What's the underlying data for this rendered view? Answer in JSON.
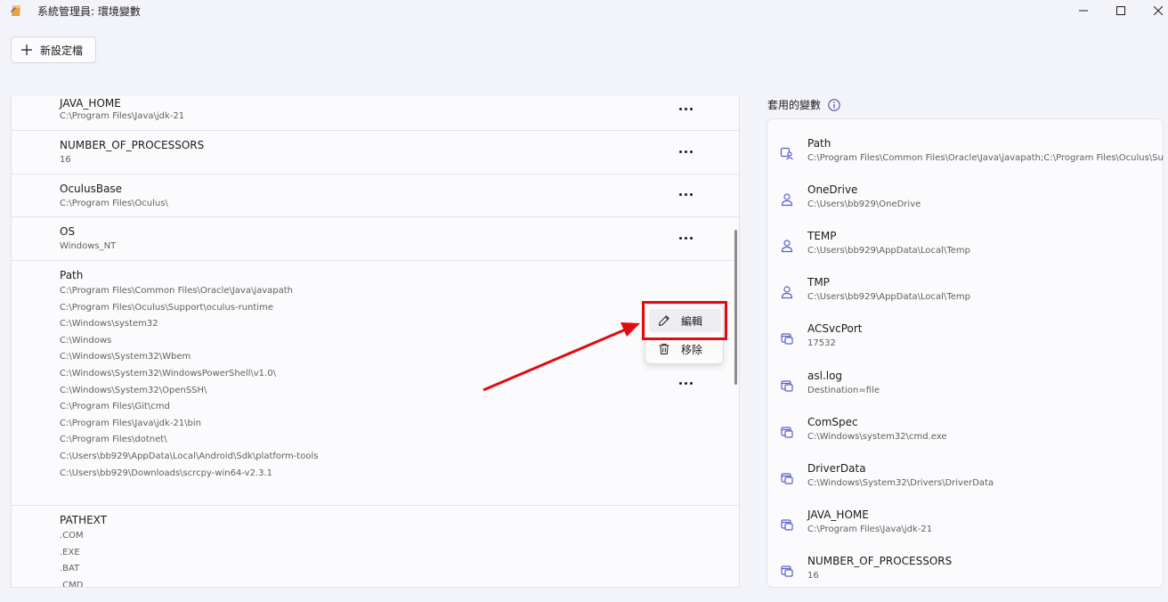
{
  "window": {
    "title": "系統管理員: 環境變數",
    "colors": {
      "accent": "#5b5fc7",
      "highlight": "#e00c10"
    }
  },
  "toolbar": {
    "new_profile_label": "新設定檔"
  },
  "variables": [
    {
      "name": "JAVA_HOME",
      "values": [
        "C:\\Program Files\\Java\\jdk-21"
      ]
    },
    {
      "name": "NUMBER_OF_PROCESSORS",
      "values": [
        "16"
      ]
    },
    {
      "name": "OculusBase",
      "values": [
        "C:\\Program Files\\Oculus\\"
      ]
    },
    {
      "name": "OS",
      "values": [
        "Windows_NT"
      ]
    },
    {
      "name": "Path",
      "values": [
        "C:\\Program Files\\Common Files\\Oracle\\Java\\javapath",
        "C:\\Program Files\\Oculus\\Support\\oculus-runtime",
        "C:\\Windows\\system32",
        "C:\\Windows",
        "C:\\Windows\\System32\\Wbem",
        "C:\\Windows\\System32\\WindowsPowerShell\\v1.0\\",
        "C:\\Windows\\System32\\OpenSSH\\",
        "C:\\Program Files\\Git\\cmd",
        "C:\\Program Files\\Java\\jdk-21\\bin",
        "C:\\Program Files\\dotnet\\",
        "C:\\Users\\bb929\\AppData\\Local\\Android\\Sdk\\platform-tools",
        "C:\\Users\\bb929\\Downloads\\scrcpy-win64-v2.3.1"
      ]
    },
    {
      "name": "PATHEXT",
      "values": [
        ".COM",
        ".EXE",
        ".BAT",
        ".CMD"
      ]
    }
  ],
  "context_menu": {
    "edit_label": "編輯",
    "remove_label": "移除"
  },
  "applied": {
    "title": "套用的變數",
    "items": [
      {
        "name": "Path",
        "value": "C:\\Program Files\\Common Files\\Oracle\\Java\\javapath;C:\\Program Files\\Oculus\\Sup",
        "icon": "system-user-icon"
      },
      {
        "name": "OneDrive",
        "value": "C:\\Users\\bb929\\OneDrive",
        "icon": "user-icon"
      },
      {
        "name": "TEMP",
        "value": "C:\\Users\\bb929\\AppData\\Local\\Temp",
        "icon": "user-icon"
      },
      {
        "name": "TMP",
        "value": "C:\\Users\\bb929\\AppData\\Local\\Temp",
        "icon": "user-icon"
      },
      {
        "name": "ACSvcPort",
        "value": "17532",
        "icon": "system-icon"
      },
      {
        "name": "asl.log",
        "value": "Destination=file",
        "icon": "system-icon"
      },
      {
        "name": "ComSpec",
        "value": "C:\\Windows\\system32\\cmd.exe",
        "icon": "system-icon"
      },
      {
        "name": "DriverData",
        "value": "C:\\Windows\\System32\\Drivers\\DriverData",
        "icon": "system-icon"
      },
      {
        "name": "JAVA_HOME",
        "value": "C:\\Program Files\\Java\\jdk-21",
        "icon": "system-icon"
      },
      {
        "name": "NUMBER_OF_PROCESSORS",
        "value": "16",
        "icon": "system-icon"
      }
    ]
  }
}
